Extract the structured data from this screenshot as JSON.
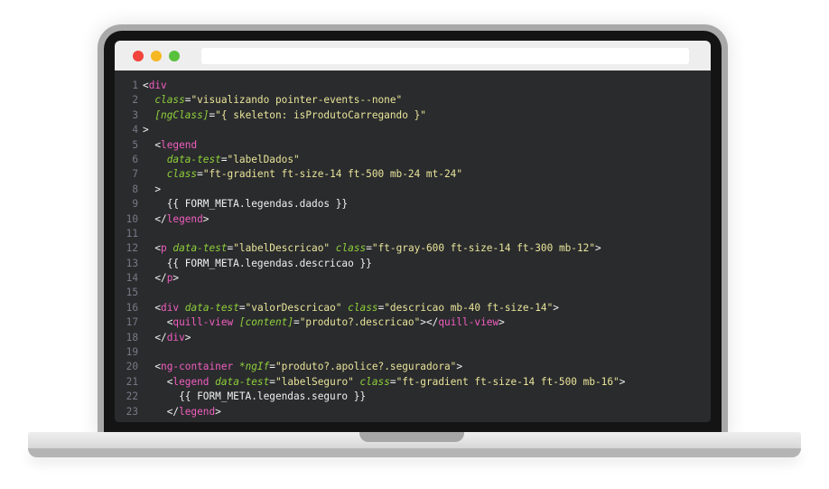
{
  "window": {
    "controls": [
      {
        "name": "close",
        "color": "#f0443c"
      },
      {
        "name": "minimize",
        "color": "#f6b722"
      },
      {
        "name": "maximize",
        "color": "#58c13c"
      }
    ],
    "address_bar": ""
  },
  "editor": {
    "colors": {
      "background": "#2a2b2d",
      "tag": "#f15ec0",
      "attribute": "#8fd13a",
      "string": "#e9e59a",
      "text": "#f0f0f0",
      "line_number": "#767a86"
    },
    "lines": [
      {
        "n": "1",
        "tokens": [
          {
            "t": "pun",
            "v": "<"
          },
          {
            "t": "tag",
            "v": "div"
          }
        ]
      },
      {
        "n": "2",
        "tokens": [
          {
            "t": "plain",
            "v": "  "
          },
          {
            "t": "attr",
            "v": "class"
          },
          {
            "t": "pun",
            "v": "="
          },
          {
            "t": "str",
            "v": "\"visualizando pointer-events--none\""
          }
        ]
      },
      {
        "n": "3",
        "tokens": [
          {
            "t": "plain",
            "v": "  "
          },
          {
            "t": "attr",
            "v": "[ngClass]"
          },
          {
            "t": "pun",
            "v": "="
          },
          {
            "t": "str",
            "v": "\"{ skeleton: isProdutoCarregando }\""
          }
        ]
      },
      {
        "n": "4",
        "tokens": [
          {
            "t": "pun",
            "v": ">"
          }
        ]
      },
      {
        "n": "5",
        "tokens": [
          {
            "t": "plain",
            "v": "  "
          },
          {
            "t": "pun",
            "v": "<"
          },
          {
            "t": "tag",
            "v": "legend"
          }
        ]
      },
      {
        "n": "6",
        "tokens": [
          {
            "t": "plain",
            "v": "    "
          },
          {
            "t": "attr",
            "v": "data-test"
          },
          {
            "t": "pun",
            "v": "="
          },
          {
            "t": "str",
            "v": "\"labelDados\""
          }
        ]
      },
      {
        "n": "7",
        "tokens": [
          {
            "t": "plain",
            "v": "    "
          },
          {
            "t": "attr",
            "v": "class"
          },
          {
            "t": "pun",
            "v": "="
          },
          {
            "t": "str",
            "v": "\"ft-gradient ft-size-14 ft-500 mb-24 mt-24\""
          }
        ]
      },
      {
        "n": "8",
        "tokens": [
          {
            "t": "plain",
            "v": "  "
          },
          {
            "t": "pun",
            "v": ">"
          }
        ]
      },
      {
        "n": "9",
        "tokens": [
          {
            "t": "plain",
            "v": "    {{ FORM_META.legendas.dados }}"
          }
        ]
      },
      {
        "n": "10",
        "tokens": [
          {
            "t": "plain",
            "v": "  "
          },
          {
            "t": "pun",
            "v": "</"
          },
          {
            "t": "tag",
            "v": "legend"
          },
          {
            "t": "pun",
            "v": ">"
          }
        ]
      },
      {
        "n": "11",
        "tokens": []
      },
      {
        "n": "12",
        "tokens": [
          {
            "t": "plain",
            "v": "  "
          },
          {
            "t": "pun",
            "v": "<"
          },
          {
            "t": "tag",
            "v": "p"
          },
          {
            "t": "plain",
            "v": " "
          },
          {
            "t": "attr",
            "v": "data-test"
          },
          {
            "t": "pun",
            "v": "="
          },
          {
            "t": "str",
            "v": "\"labelDescricao\""
          },
          {
            "t": "plain",
            "v": " "
          },
          {
            "t": "attr",
            "v": "class"
          },
          {
            "t": "pun",
            "v": "="
          },
          {
            "t": "str",
            "v": "\"ft-gray-600 ft-size-14 ft-300 mb-12\""
          },
          {
            "t": "pun",
            "v": ">"
          }
        ]
      },
      {
        "n": "13",
        "tokens": [
          {
            "t": "plain",
            "v": "    {{ FORM_META.legendas.descricao }}"
          }
        ]
      },
      {
        "n": "14",
        "tokens": [
          {
            "t": "plain",
            "v": "  "
          },
          {
            "t": "pun",
            "v": "</"
          },
          {
            "t": "tag",
            "v": "p"
          },
          {
            "t": "pun",
            "v": ">"
          }
        ]
      },
      {
        "n": "15",
        "tokens": []
      },
      {
        "n": "16",
        "tokens": [
          {
            "t": "plain",
            "v": "  "
          },
          {
            "t": "pun",
            "v": "<"
          },
          {
            "t": "tag",
            "v": "div"
          },
          {
            "t": "plain",
            "v": " "
          },
          {
            "t": "attr",
            "v": "data-test"
          },
          {
            "t": "pun",
            "v": "="
          },
          {
            "t": "str",
            "v": "\"valorDescricao\""
          },
          {
            "t": "plain",
            "v": " "
          },
          {
            "t": "attr",
            "v": "class"
          },
          {
            "t": "pun",
            "v": "="
          },
          {
            "t": "str",
            "v": "\"descricao mb-40 ft-size-14\""
          },
          {
            "t": "pun",
            "v": ">"
          }
        ]
      },
      {
        "n": "17",
        "tokens": [
          {
            "t": "plain",
            "v": "    "
          },
          {
            "t": "pun",
            "v": "<"
          },
          {
            "t": "tag",
            "v": "quill-view"
          },
          {
            "t": "plain",
            "v": " "
          },
          {
            "t": "attr",
            "v": "[content]"
          },
          {
            "t": "pun",
            "v": "="
          },
          {
            "t": "str",
            "v": "\"produto?.descricao\""
          },
          {
            "t": "pun",
            "v": "></"
          },
          {
            "t": "tag",
            "v": "quill-view"
          },
          {
            "t": "pun",
            "v": ">"
          }
        ]
      },
      {
        "n": "18",
        "tokens": [
          {
            "t": "plain",
            "v": "  "
          },
          {
            "t": "pun",
            "v": "</"
          },
          {
            "t": "tag",
            "v": "div"
          },
          {
            "t": "pun",
            "v": ">"
          }
        ]
      },
      {
        "n": "19",
        "tokens": []
      },
      {
        "n": "20",
        "tokens": [
          {
            "t": "plain",
            "v": "  "
          },
          {
            "t": "pun",
            "v": "<"
          },
          {
            "t": "tag",
            "v": "ng-container"
          },
          {
            "t": "plain",
            "v": " "
          },
          {
            "t": "attr",
            "v": "*ngIf"
          },
          {
            "t": "pun",
            "v": "="
          },
          {
            "t": "str",
            "v": "\"produto?.apolice?.seguradora\""
          },
          {
            "t": "pun",
            "v": ">"
          }
        ]
      },
      {
        "n": "21",
        "tokens": [
          {
            "t": "plain",
            "v": "    "
          },
          {
            "t": "pun",
            "v": "<"
          },
          {
            "t": "tag",
            "v": "legend"
          },
          {
            "t": "plain",
            "v": " "
          },
          {
            "t": "attr",
            "v": "data-test"
          },
          {
            "t": "pun",
            "v": "="
          },
          {
            "t": "str",
            "v": "\"labelSeguro\""
          },
          {
            "t": "plain",
            "v": " "
          },
          {
            "t": "attr",
            "v": "class"
          },
          {
            "t": "pun",
            "v": "="
          },
          {
            "t": "str",
            "v": "\"ft-gradient ft-size-14 ft-500 mb-16\""
          },
          {
            "t": "pun",
            "v": ">"
          }
        ]
      },
      {
        "n": "22",
        "tokens": [
          {
            "t": "plain",
            "v": "      {{ FORM_META.legendas.seguro }}"
          }
        ]
      },
      {
        "n": "23",
        "tokens": [
          {
            "t": "plain",
            "v": "    "
          },
          {
            "t": "pun",
            "v": "</"
          },
          {
            "t": "tag",
            "v": "legend"
          },
          {
            "t": "pun",
            "v": ">"
          }
        ]
      }
    ]
  }
}
